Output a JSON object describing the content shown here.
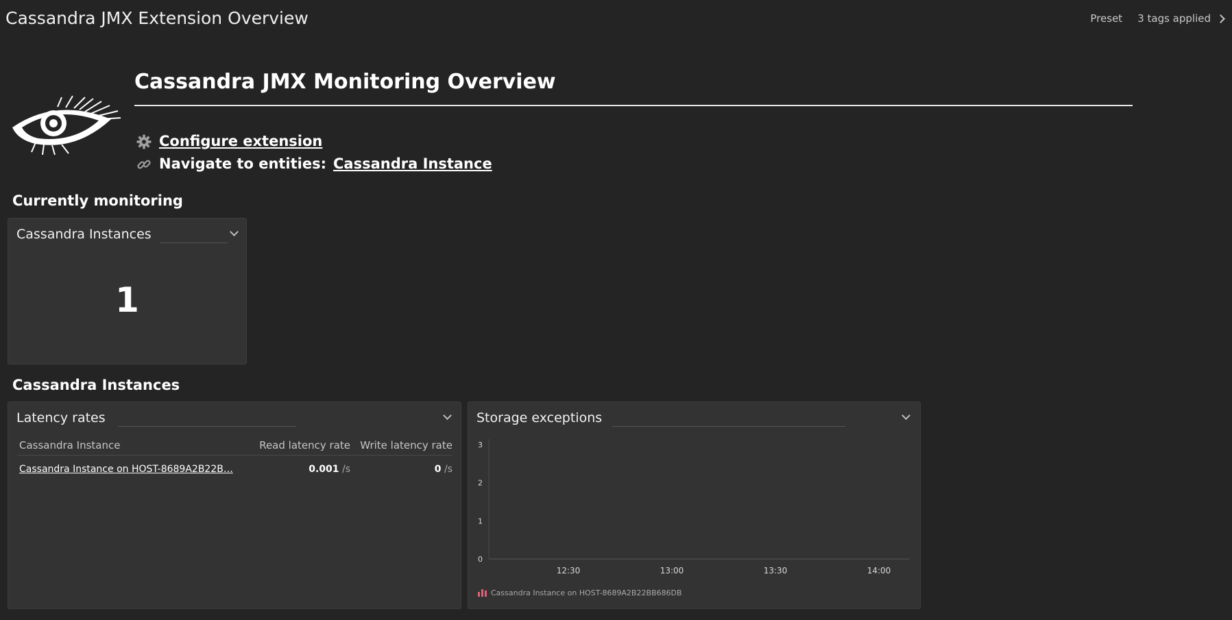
{
  "topbar": {
    "title": "Cassandra JMX Extension Overview",
    "preset": "Preset",
    "tags": "3 tags applied"
  },
  "header": {
    "title": "Cassandra JMX Monitoring Overview",
    "configure_link": "Configure extension",
    "navigate_label": "Navigate to entities:",
    "navigate_link": "Cassandra Instance"
  },
  "sections": {
    "currently_monitoring": "Currently monitoring",
    "cassandra_instances": "Cassandra Instances"
  },
  "instances_tile": {
    "title": "Cassandra Instances",
    "value": "1"
  },
  "latency_tile": {
    "title": "Latency rates",
    "columns": [
      "Cassandra Instance",
      "Read latency rate",
      "Write latency rate"
    ],
    "rows": [
      {
        "instance": "Cassandra Instance on HOST-8689A2B22B…",
        "read_value": "0.001",
        "read_unit": "/s",
        "write_value": "0",
        "write_unit": "/s"
      }
    ]
  },
  "storage_tile": {
    "title": "Storage exceptions",
    "legend": "Cassandra Instance on HOST-8689A2B22BB686DB"
  },
  "chart_data": {
    "type": "bar",
    "title": "Storage exceptions",
    "x_ticks": [
      "12:30",
      "13:00",
      "13:30",
      "14:00"
    ],
    "y_ticks": [
      "0",
      "1",
      "2",
      "3"
    ],
    "ylim": [
      0,
      3
    ],
    "series": [
      {
        "name": "Cassandra Instance on HOST-8689A2B22BB686DB",
        "values": []
      }
    ],
    "legend_position": "bottom-left",
    "colors": {
      "series": "#e0607a"
    }
  }
}
